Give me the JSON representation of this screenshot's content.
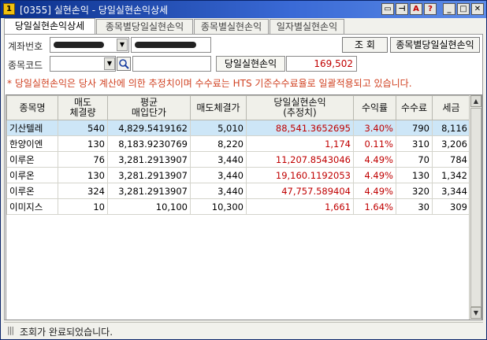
{
  "window": {
    "title": "[0355] 실현손익 - 당일실현손익상세",
    "icon_label": "1",
    "controls": [
      "screen-icon",
      "pin-icon",
      "font-icon",
      "help-icon",
      "minimize-icon",
      "maximize-icon",
      "close-icon"
    ],
    "control_glyphs": [
      "▭",
      "⊣",
      "A",
      "?",
      "_",
      "□",
      "✕"
    ]
  },
  "tabs": [
    {
      "label": "당일실현손익상세",
      "active": true
    },
    {
      "label": "종목별당일실현손익",
      "active": false
    },
    {
      "label": "종목별실현손익",
      "active": false
    },
    {
      "label": "일자별실현손익",
      "active": false
    }
  ],
  "form": {
    "account_label": "계좌번호",
    "account_value": "",
    "stock_code_label": "종목코드",
    "stock_code_value": "",
    "stock_name_value": "",
    "query_button": "조 회",
    "by_stock_button": "종목별당일실현손익",
    "realized_label": "당일실현손익",
    "realized_value": "169,502"
  },
  "notice": "* 당일실현손익은 당사 계산에 의한 추정치이며 수수료는 HTS 기준수수료율로 일괄적용되고 있습니다.",
  "table": {
    "columns": [
      {
        "line1": "종목명",
        "line2": ""
      },
      {
        "line1": "매도",
        "line2": "체결량"
      },
      {
        "line1": "평균",
        "line2": "매입단가"
      },
      {
        "line1": "매도체결가",
        "line2": ""
      },
      {
        "line1": "당일실현손익",
        "line2": "(추정치)"
      },
      {
        "line1": "수익률",
        "line2": ""
      },
      {
        "line1": "수수료",
        "line2": ""
      },
      {
        "line1": "세금",
        "line2": ""
      }
    ],
    "rows": [
      {
        "name": "기산텔레",
        "qty": "540",
        "avg_price": "4,829.5419162",
        "sell_price": "5,010",
        "pnl": "88,541.3652695",
        "rate": "3.40%",
        "fee": "790",
        "tax": "8,116"
      },
      {
        "name": "한양이엔",
        "qty": "130",
        "avg_price": "8,183.9230769",
        "sell_price": "8,220",
        "pnl": "1,174",
        "rate": "0.11%",
        "fee": "310",
        "tax": "3,206"
      },
      {
        "name": "이루온",
        "qty": "76",
        "avg_price": "3,281.2913907",
        "sell_price": "3,440",
        "pnl": "11,207.8543046",
        "rate": "4.49%",
        "fee": "70",
        "tax": "784"
      },
      {
        "name": "이루온",
        "qty": "130",
        "avg_price": "3,281.2913907",
        "sell_price": "3,440",
        "pnl": "19,160.1192053",
        "rate": "4.49%",
        "fee": "130",
        "tax": "1,342"
      },
      {
        "name": "이루온",
        "qty": "324",
        "avg_price": "3,281.2913907",
        "sell_price": "3,440",
        "pnl": "47,757.589404",
        "rate": "4.49%",
        "fee": "320",
        "tax": "3,344"
      },
      {
        "name": "이미지스",
        "qty": "10",
        "avg_price": "10,100",
        "sell_price": "10,300",
        "pnl": "1,661",
        "rate": "1.64%",
        "fee": "30",
        "tax": "309"
      }
    ],
    "selected_row": 0
  },
  "status": {
    "text": "조회가 완료되었습니다."
  },
  "colors": {
    "title_bar": "#0a2f8a",
    "profit_text": "#c00000",
    "notice_text": "#d04020",
    "selected_row": "#cde6f7"
  }
}
